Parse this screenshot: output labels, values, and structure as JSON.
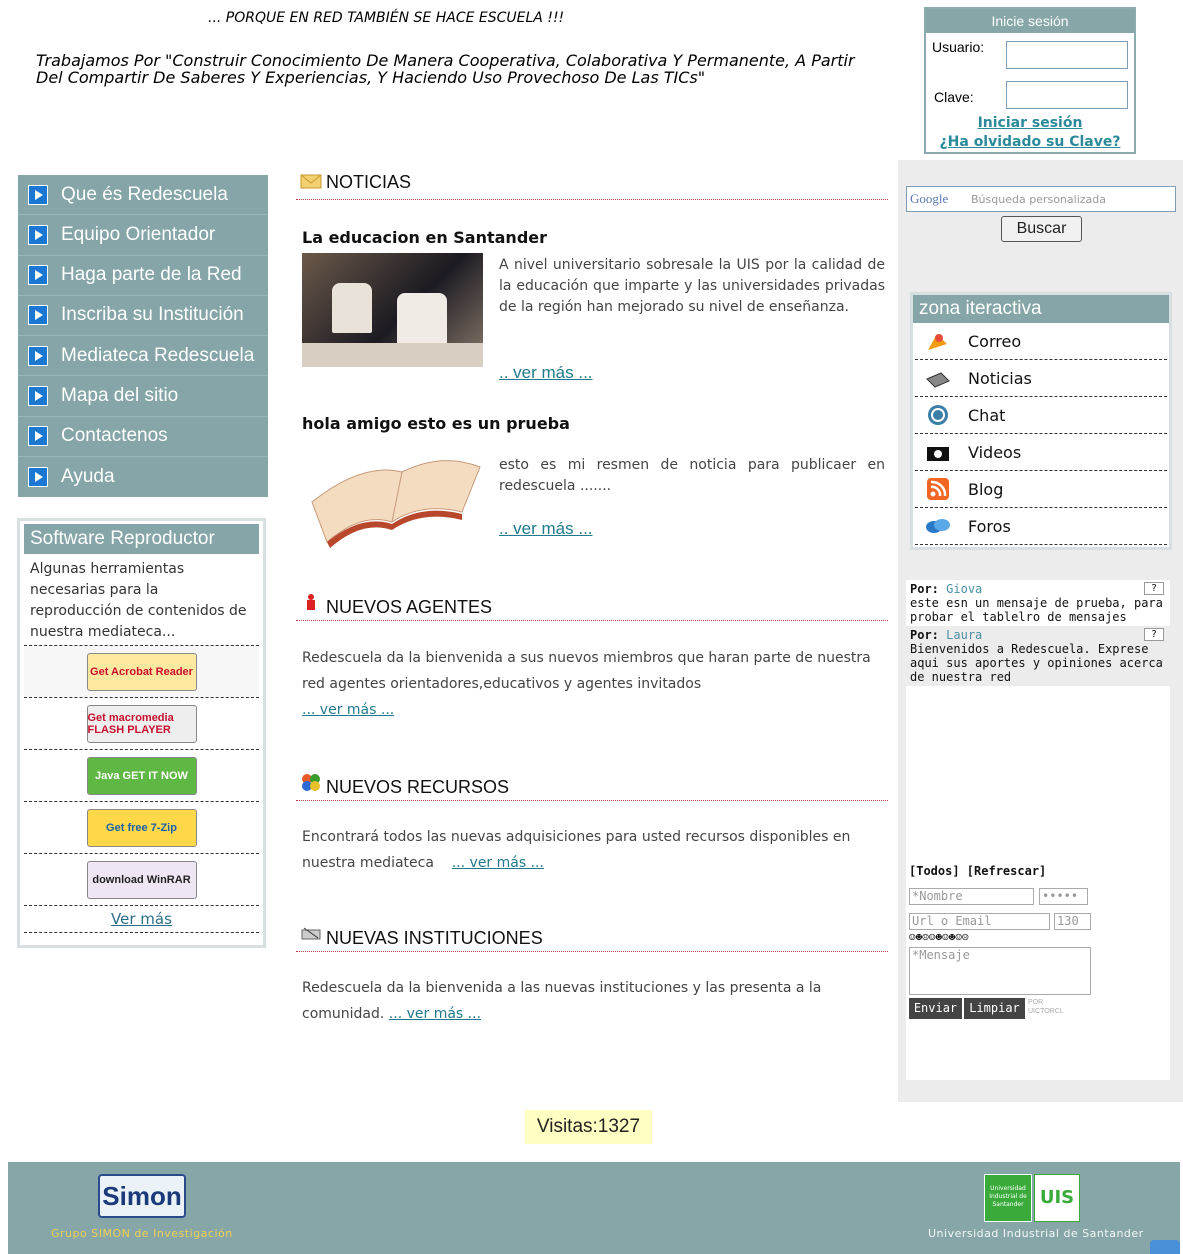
{
  "header": {
    "slogan": "... PORQUE EN RED TAMBIÉN SE HACE ESCUELA !!!",
    "mission": "Trabajamos Por \"Construir Conocimiento De Manera Cooperativa, Colaborativa Y Permanente, A Partir Del Compartir De Saberes Y Experiencias, Y Haciendo Uso Provechoso De Las TICs\""
  },
  "login": {
    "title": "Inicie sesión",
    "user_label": "Usuario:",
    "pass_label": "Clave:",
    "login_link": "Iniciar sesión",
    "forgot_link": "¿Ha olvidado su Clave?"
  },
  "menu": {
    "items": [
      {
        "label": "Que és Redescuela"
      },
      {
        "label": "Equipo Orientador"
      },
      {
        "label": "Haga parte de la Red"
      },
      {
        "label": "Inscriba su Institución"
      },
      {
        "label": "Mediateca Redescuela"
      },
      {
        "label": "Mapa del sitio"
      },
      {
        "label": "Contactenos"
      },
      {
        "label": "Ayuda"
      }
    ]
  },
  "software": {
    "title": "Software Reproductor",
    "description": "Algunas herramientas necesarias para la reproducción de contenidos de nuestra mediateca...",
    "items": [
      {
        "label": "Get Acrobat Reader",
        "color": "#c8102e"
      },
      {
        "label": "Get macromedia FLASH PLAYER",
        "color": "#c8102e"
      },
      {
        "label": "Java GET IT NOW",
        "color": "#3a9a2a"
      },
      {
        "label": "Get free 7-Zip",
        "color": "#1d5fa8"
      },
      {
        "label": "download WinRAR",
        "color": "#6a2a8a"
      }
    ],
    "more": "Ver más"
  },
  "news": {
    "heading": "NOTICIAS",
    "items": [
      {
        "title": "La educacion en Santander",
        "text": "A nivel universitario sobresale la UIS por la calidad de la educación que imparte y las universidades privadas de la región han mejorado su nivel de enseñanza.",
        "more": ".. ver más ..."
      },
      {
        "title": "hola amigo esto es un prueba",
        "text": "esto es mi resmen de noticia para publicaer en redescuela .......",
        "more": ".. ver más ..."
      }
    ]
  },
  "agents": {
    "heading": "NUEVOS AGENTES",
    "text": "Redescuela da la bienvenida a sus nuevos miembros que haran parte de nuestra red agentes orientadores,educativos y agentes invitados",
    "more": "... ver más ..."
  },
  "resources": {
    "heading": "NUEVOS RECURSOS",
    "text": "Encontrará todos las nuevas adquisiciones para usted recursos disponibles en nuestra mediateca",
    "more": "... ver más ..."
  },
  "institutions": {
    "heading": "NUEVAS INSTITUCIONES",
    "text": "Redescuela da la bienvenida a las nuevas instituciones y las presenta a la comunidad.",
    "more": "... ver más ..."
  },
  "search": {
    "placeholder": "Búsqueda personalizada",
    "logo": "Google",
    "button": "Buscar"
  },
  "zone": {
    "title": "zona iteractiva",
    "items": [
      {
        "label": "Correo",
        "icon": "mail-icon"
      },
      {
        "label": "Noticias",
        "icon": "news-icon"
      },
      {
        "label": "Chat",
        "icon": "chat-icon"
      },
      {
        "label": "Videos",
        "icon": "video-icon"
      },
      {
        "label": "Blog",
        "icon": "rss-icon"
      },
      {
        "label": "Foros",
        "icon": "forum-icon"
      }
    ]
  },
  "board": {
    "messages": [
      {
        "by": "Por:",
        "author": "Giova",
        "text": "este esn un mensaje de prueba, para probar el tablelro de mensajes"
      },
      {
        "by": "Por:",
        "author": "Laura",
        "text": "Bienvenidos a Redescuela. Exprese aqui sus aportes y opiniones acerca de nuestra red"
      }
    ],
    "help": "?",
    "links": "[Todos] [Refrescar]",
    "name_placeholder": "*Nombre",
    "pass_placeholder": "•••••",
    "url_placeholder": "Url o Email",
    "counter": "130",
    "smileys": "☺☻☹☺☻☺☻☺☹",
    "message_placeholder": "*Mensaje",
    "send": "Enviar",
    "clear": "Limpiar",
    "by_credit": "POR UICTORCL"
  },
  "visits": "Visitas:1327",
  "footer": {
    "left_logo": "Simon",
    "left_caption": "Grupo SIMON de Investigación",
    "right_logo_text": "Universidad Industrial de Santander",
    "right_logo_mark": "UIS",
    "right_caption": "Universidad Industrial de Santander"
  }
}
